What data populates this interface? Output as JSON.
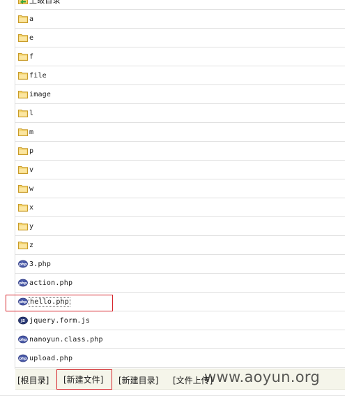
{
  "file_list": {
    "up_label": "上级目录",
    "items": [
      {
        "name": "a",
        "icon": "folder-icon"
      },
      {
        "name": "e",
        "icon": "folder-icon"
      },
      {
        "name": "f",
        "icon": "folder-icon"
      },
      {
        "name": "file",
        "icon": "folder-icon"
      },
      {
        "name": "image",
        "icon": "folder-icon"
      },
      {
        "name": "l",
        "icon": "folder-icon"
      },
      {
        "name": "m",
        "icon": "folder-icon"
      },
      {
        "name": "p",
        "icon": "folder-icon"
      },
      {
        "name": "v",
        "icon": "folder-icon"
      },
      {
        "name": "w",
        "icon": "folder-icon"
      },
      {
        "name": "x",
        "icon": "folder-icon"
      },
      {
        "name": "y",
        "icon": "folder-icon"
      },
      {
        "name": "z",
        "icon": "folder-icon"
      },
      {
        "name": "3.php",
        "icon": "php-file-icon"
      },
      {
        "name": "action.php",
        "icon": "php-file-icon"
      },
      {
        "name": "hello.php",
        "icon": "php-file-icon"
      },
      {
        "name": "jquery.form.js",
        "icon": "js-file-icon"
      },
      {
        "name": "nanoyun.class.php",
        "icon": "php-file-icon"
      },
      {
        "name": "upload.php",
        "icon": "php-file-icon"
      }
    ]
  },
  "toolbar": {
    "root_label": "[根目录]",
    "new_file_label": "[新建文件]",
    "new_dir_label": "[新建目录]",
    "upload_label": "[文件上传]"
  },
  "watermark": "www.aoyun.org",
  "colors": {
    "highlight": "#d6262c",
    "folder": "#f3d36b",
    "php_icon": "#4a5aa8",
    "js_icon": "#2c3b78",
    "toolbar_bg": "#f5f5ea"
  }
}
